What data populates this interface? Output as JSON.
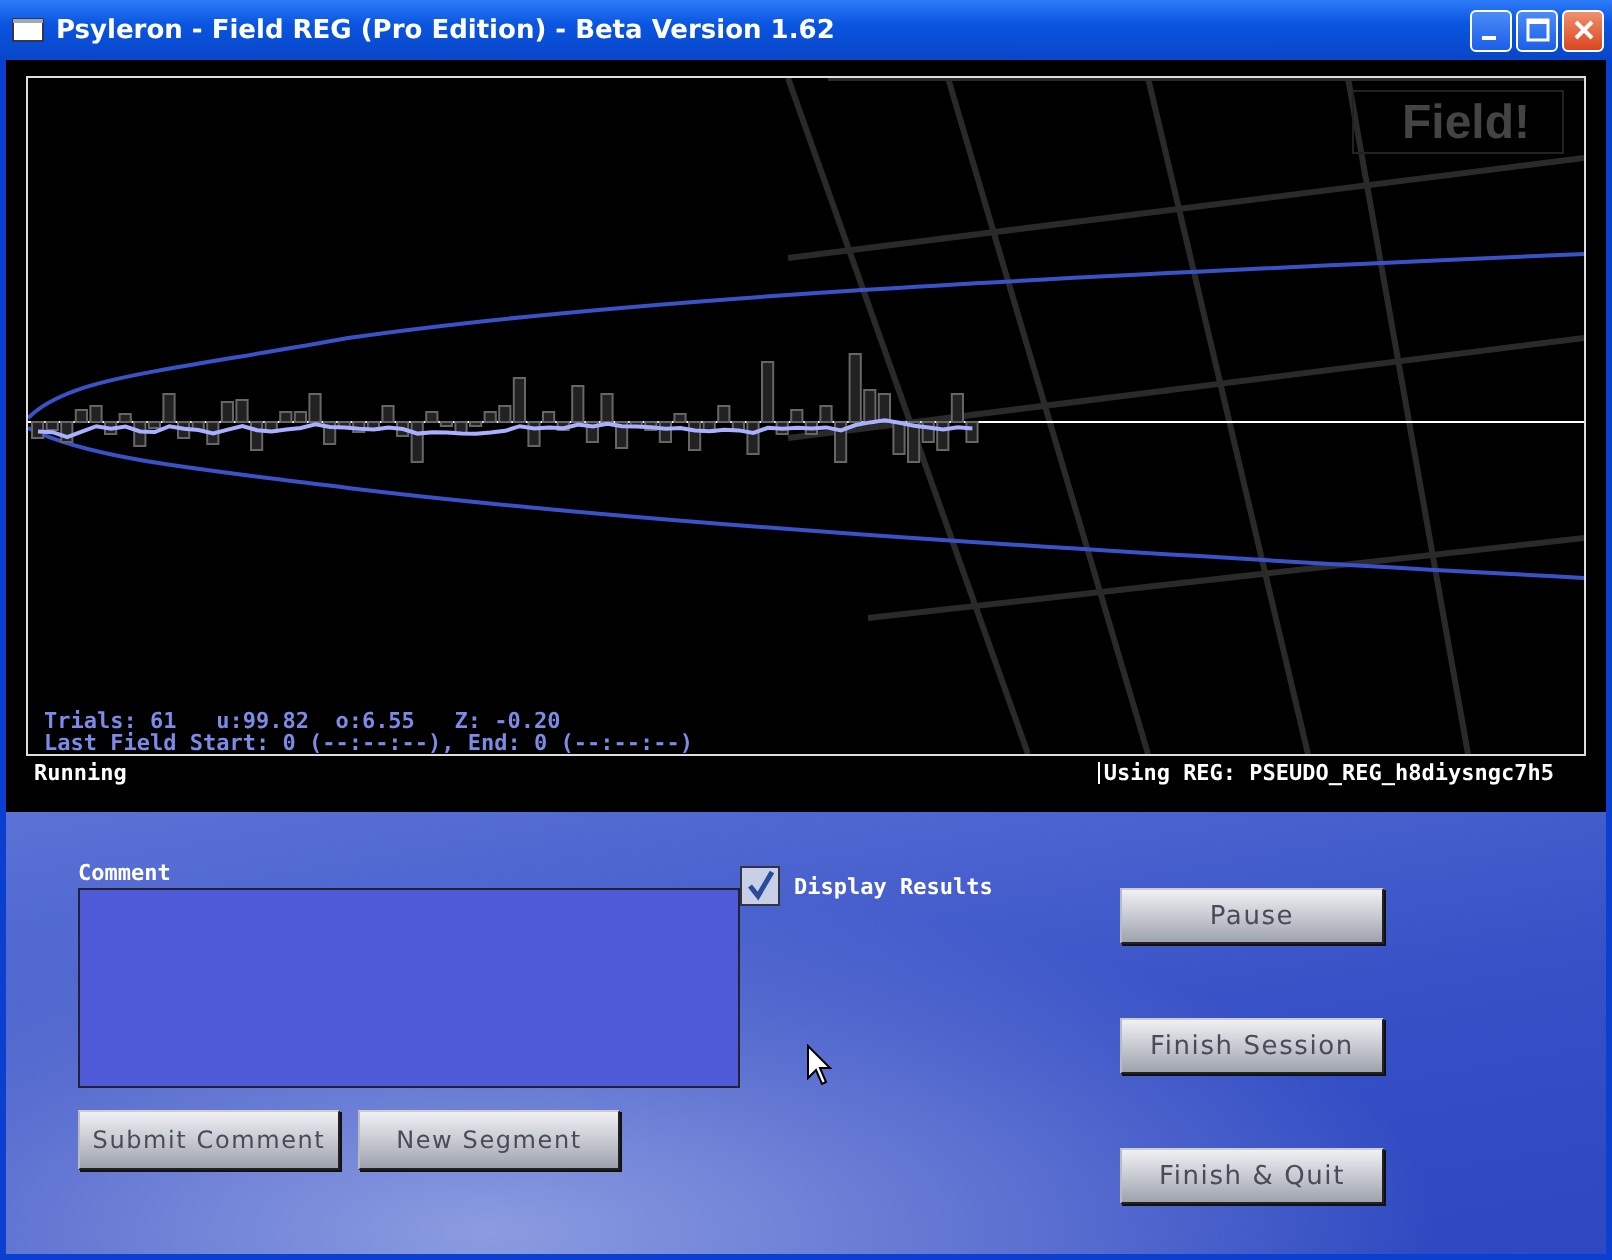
{
  "window": {
    "title": "Psyleron - Field REG (Pro Edition) - Beta Version 1.62"
  },
  "display": {
    "badge": "Field!",
    "stats": "Trials: 61   u:99.82  o:6.55   Z: -0.20",
    "last_field": "Last Field Start: 0 (--:--:--), End: 0 (--:--:--)",
    "status": "Running",
    "source": "Using REG: PSEUDO_REG_h8diysngc7h5"
  },
  "comment": {
    "label": "Comment"
  },
  "buttons_left": [
    "Submit Comment",
    "New Segment"
  ],
  "display_results": {
    "label": "Display Results",
    "checked": true
  },
  "buttons_right": [
    "Pause",
    "Finish Session",
    "Finish & Quit"
  ]
}
